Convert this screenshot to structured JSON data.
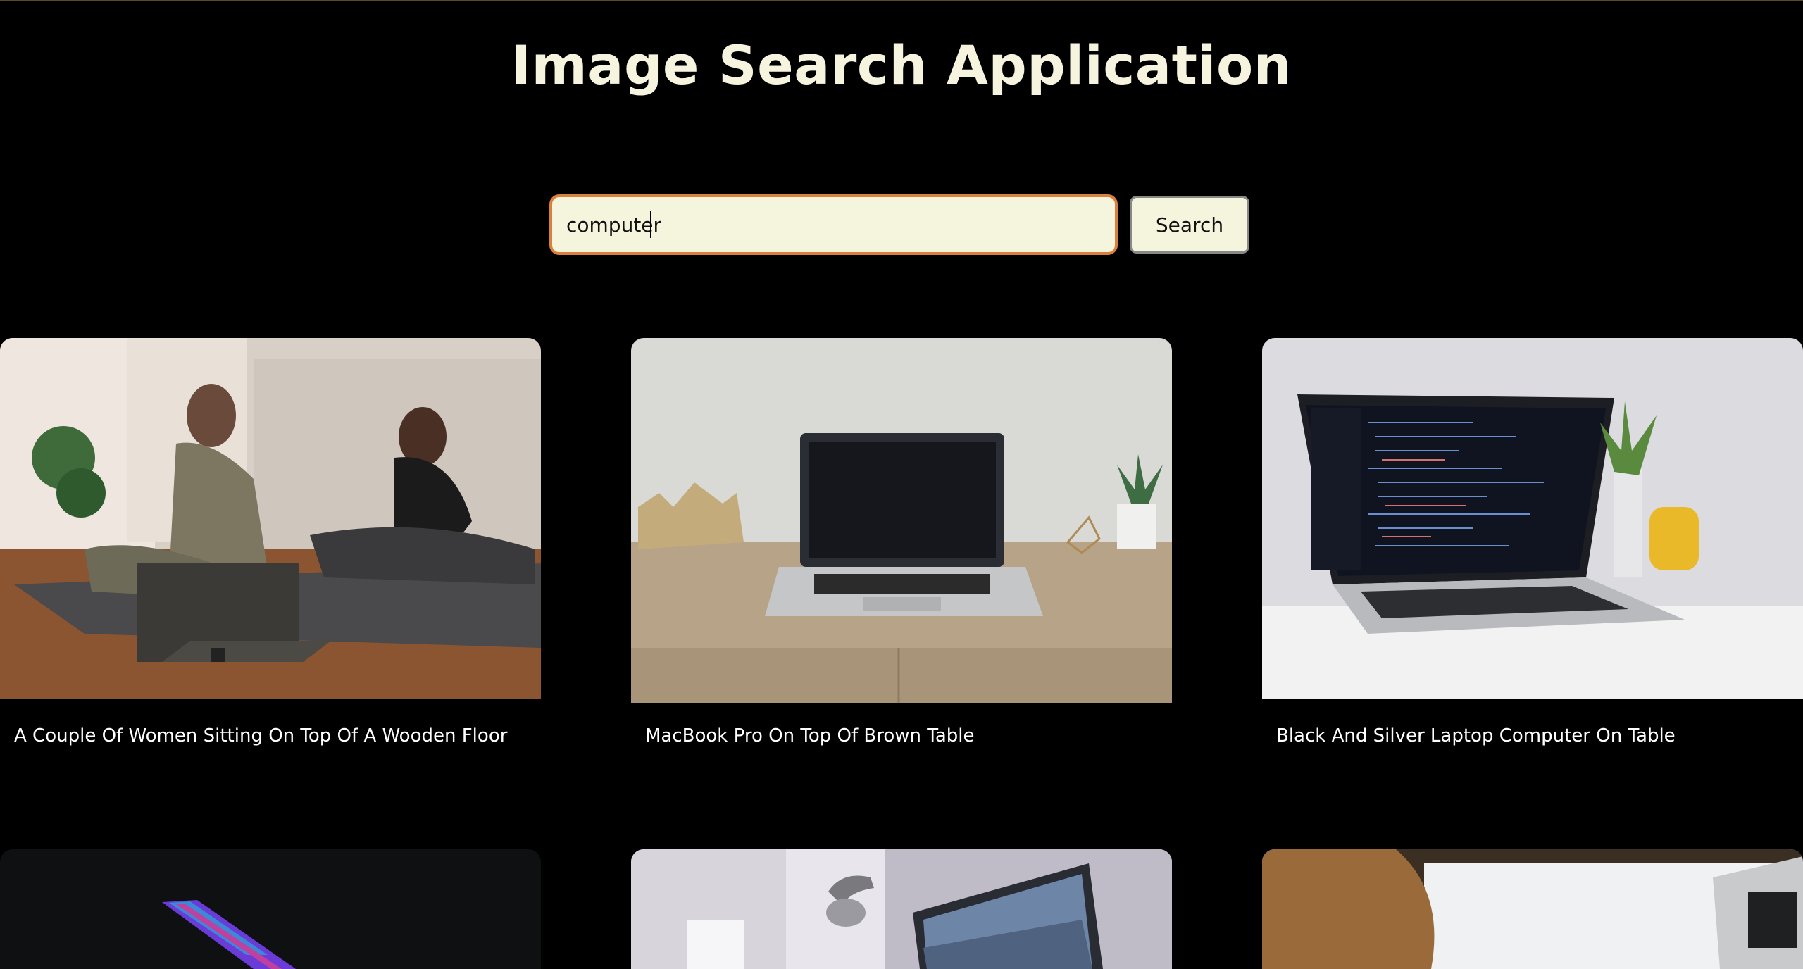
{
  "app": {
    "title": "Image Search Application"
  },
  "search": {
    "value": "computer",
    "button_label": "Search"
  },
  "colors": {
    "background": "#000000",
    "title": "#f6f4de",
    "input_bg": "#f5f4dc",
    "input_border": "#d9803d"
  },
  "results": [
    {
      "caption": "A Couple Of Women Sitting On Top Of A Wooden Floor"
    },
    {
      "caption": "MacBook Pro On Top Of Brown Table"
    },
    {
      "caption": "Black And Silver Laptop Computer On Table"
    },
    {
      "caption": ""
    },
    {
      "caption": ""
    },
    {
      "caption": ""
    }
  ]
}
